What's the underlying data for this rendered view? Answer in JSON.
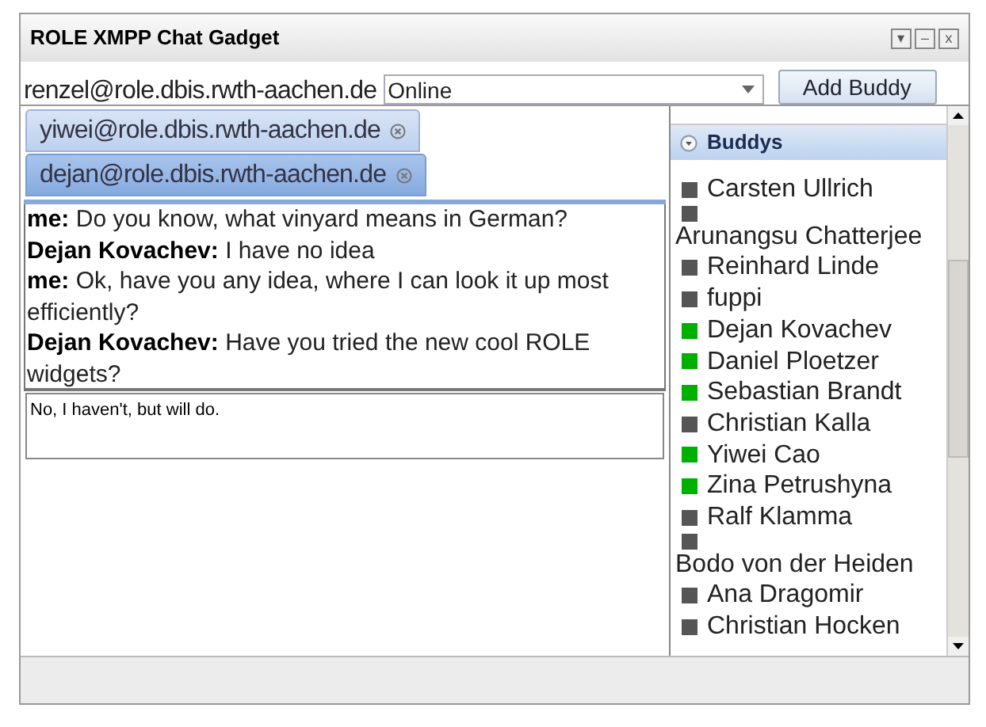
{
  "window": {
    "title": "ROLE XMPP Chat Gadget",
    "controls": [
      "▾",
      "–",
      "x"
    ]
  },
  "toolbar": {
    "account": "renzel@role.dbis.rwth-aachen.de",
    "status": "Online",
    "add_button": "Add Buddy"
  },
  "tabs": [
    {
      "label": "yiwei@role.dbis.rwth-aachen.de",
      "selected": false
    },
    {
      "label": "dejan@role.dbis.rwth-aachen.de",
      "selected": true
    }
  ],
  "messages": [
    {
      "sender": "me:",
      "text": "Do you know, what vinyard means in German?"
    },
    {
      "sender": "Dejan Kovachev:",
      "text": "I have no idea"
    },
    {
      "sender": "me:",
      "text": "Ok, have you any idea, where I can look it up most efficiently?"
    },
    {
      "sender": "Dejan Kovachev:",
      "text": "Have you tried the new cool ROLE widgets?"
    }
  ],
  "message_input": {
    "value": "No, I haven't, but will do."
  },
  "buddies": {
    "title": "Buddys",
    "expanded": true,
    "items": [
      {
        "name": "Carsten Ullrich",
        "online": false
      },
      {
        "name": "Arunangsu Chatterjee",
        "online": false
      },
      {
        "name": "Reinhard Linde",
        "online": false
      },
      {
        "name": "fuppi",
        "online": false
      },
      {
        "name": "Dejan Kovachev",
        "online": true
      },
      {
        "name": "Daniel Ploetzer",
        "online": true
      },
      {
        "name": "Sebastian Brandt",
        "online": true
      },
      {
        "name": "Christian Kalla",
        "online": false
      },
      {
        "name": "Yiwei Cao",
        "online": true
      },
      {
        "name": "Zina Petrushyna",
        "online": true
      },
      {
        "name": "Ralf Klamma",
        "online": false
      },
      {
        "name": "Bodo von der Heiden",
        "online": false
      },
      {
        "name": "Ana Dragomir",
        "online": false
      },
      {
        "name": "Christian Hocken",
        "online": false
      }
    ]
  }
}
